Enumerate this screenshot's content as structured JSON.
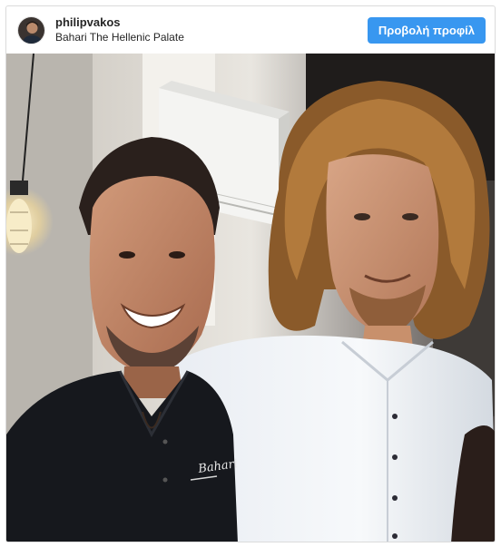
{
  "post": {
    "username": "philipvakos",
    "location": "Bahari The Hellenic Palate",
    "profile_button_label": "Προβολή προφίλ"
  },
  "photo": {
    "logo_text": "Bahari"
  },
  "colors": {
    "button_bg": "#3897f0",
    "border": "#dbdbdb",
    "text": "#262626"
  }
}
